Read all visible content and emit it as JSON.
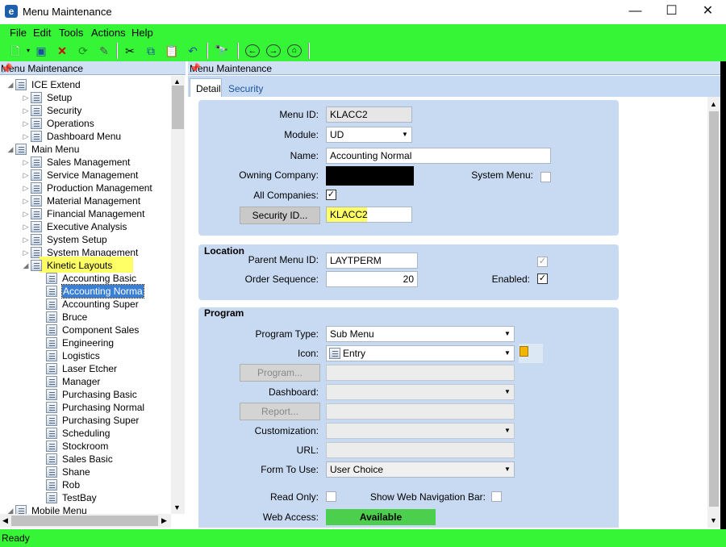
{
  "window": {
    "title": "Menu Maintenance",
    "minimize": "—",
    "maximize": "☐",
    "close": "✕"
  },
  "menubar": [
    "File",
    "Edit",
    "Tools",
    "Actions",
    "Help"
  ],
  "left_panel": {
    "title": "Menu Maintenance",
    "tree": [
      {
        "label": "ICE Extend",
        "level": 0,
        "expanded": true
      },
      {
        "label": "Setup",
        "level": 1
      },
      {
        "label": "Security",
        "level": 1
      },
      {
        "label": "Operations",
        "level": 1
      },
      {
        "label": "Dashboard Menu",
        "level": 1
      },
      {
        "label": "Main Menu",
        "level": 0,
        "expanded": true
      },
      {
        "label": "Sales Management",
        "level": 1
      },
      {
        "label": "Service Management",
        "level": 1
      },
      {
        "label": "Production Management",
        "level": 1
      },
      {
        "label": "Material Management",
        "level": 1
      },
      {
        "label": "Financial Management",
        "level": 1
      },
      {
        "label": "Executive Analysis",
        "level": 1
      },
      {
        "label": "System Setup",
        "level": 1
      },
      {
        "label": "System Management",
        "level": 1
      },
      {
        "label": "Kinetic Layouts",
        "level": 1,
        "expanded": true,
        "highlighted": true
      },
      {
        "label": "Accounting Basic",
        "level": 2
      },
      {
        "label": "Accounting Norma",
        "level": 2,
        "selected": true
      },
      {
        "label": "Accounting Super",
        "level": 2
      },
      {
        "label": "Bruce",
        "level": 2
      },
      {
        "label": "Component Sales",
        "level": 2
      },
      {
        "label": "Engineering",
        "level": 2
      },
      {
        "label": "Logistics",
        "level": 2
      },
      {
        "label": "Laser Etcher",
        "level": 2
      },
      {
        "label": "Manager",
        "level": 2
      },
      {
        "label": "Purchasing Basic",
        "level": 2
      },
      {
        "label": "Purchasing Normal",
        "level": 2
      },
      {
        "label": "Purchasing Super",
        "level": 2
      },
      {
        "label": "Scheduling",
        "level": 2
      },
      {
        "label": "Stockroom",
        "level": 2
      },
      {
        "label": "Sales Basic",
        "level": 2
      },
      {
        "label": "Shane",
        "level": 2
      },
      {
        "label": "Rob",
        "level": 2
      },
      {
        "label": "TestBay",
        "level": 2
      },
      {
        "label": "Mobile Menu",
        "level": 0,
        "expanded": true
      }
    ]
  },
  "right_panel": {
    "title": "Menu Maintenance",
    "tabs": [
      "Detail",
      "Security"
    ],
    "detail": {
      "menu_id_label": "Menu ID:",
      "menu_id": "KLACC2",
      "module_label": "Module:",
      "module": "UD",
      "name_label": "Name:",
      "name": "Accounting Normal",
      "owning_company_label": "Owning Company:",
      "owning_company": "",
      "system_menu_label": "System Menu:",
      "all_companies_label": "All Companies:",
      "security_id_button": "Security ID...",
      "security_id": "KLACC2"
    },
    "location": {
      "title": "Location",
      "parent_menu_id_label": "Parent Menu ID:",
      "parent_menu_id": "LAYTPERM",
      "order_sequence_label": "Order Sequence:",
      "order_sequence": "20",
      "enabled_label": "Enabled:"
    },
    "program": {
      "title": "Program",
      "program_type_label": "Program Type:",
      "program_type": "Sub Menu",
      "icon_label": "Icon:",
      "icon": "Entry",
      "program_button": "Program...",
      "program": "",
      "dashboard_label": "Dashboard:",
      "dashboard": "",
      "report_button": "Report...",
      "report": "",
      "customization_label": "Customization:",
      "customization": "",
      "url_label": "URL:",
      "url": "",
      "form_to_use_label": "Form To Use:",
      "form_to_use": "User Choice",
      "read_only_label": "Read Only:",
      "show_web_nav_label": "Show Web Navigation Bar:",
      "web_access_label": "Web Access:",
      "web_access": "Available"
    }
  },
  "status": "Ready",
  "colors": {
    "accent_green": "#36f536",
    "panel_blue": "#c8daf2",
    "highlight_yellow": "#ffff66",
    "available_green": "#4ccf4c"
  }
}
